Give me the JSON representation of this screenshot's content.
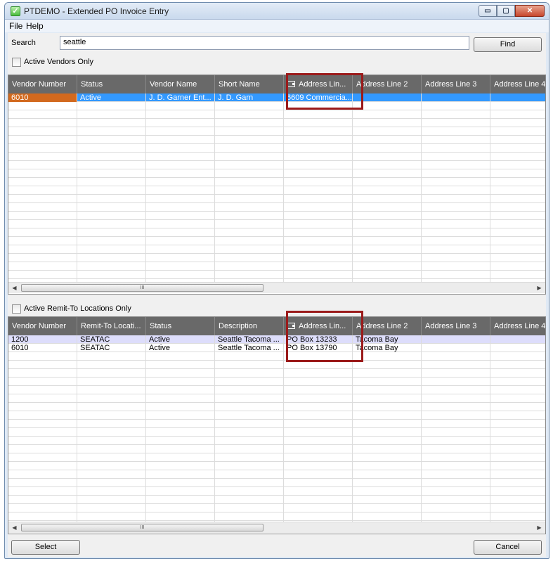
{
  "window": {
    "title": "PTDEMO - Extended PO Invoice Entry",
    "controls": [
      "minimize",
      "maximize",
      "close"
    ],
    "control_glyphs": {
      "minimize": "▭",
      "maximize": "▢",
      "close": "✕"
    }
  },
  "menu": [
    "File",
    "Help"
  ],
  "search": {
    "label": "Search",
    "value": "seattle",
    "find_label": "Find"
  },
  "vendors": {
    "filter_label": "Active Vendors Only",
    "columns": [
      "Vendor Number",
      "Status",
      "Vendor Name",
      "Short Name",
      "Address Lin...",
      "Address Line 2",
      "Address Line 3",
      "Address Line 4"
    ],
    "rows": [
      {
        "vendor_number": "6010",
        "status": "Active",
        "vendor_name": "J. D. Garner Ent...",
        "short_name": "J. D. Garn",
        "address_line_1": "6609 Commercia...",
        "address_line_2": "",
        "address_line_3": "",
        "address_line_4": ""
      }
    ],
    "scroll_marker": "III"
  },
  "remit_to": {
    "filter_label": "Active Remit-To Locations Only",
    "columns": [
      "Vendor Number",
      "Remit-To Locati...",
      "Status",
      "Description",
      "Address Lin...",
      "Address Line 2",
      "Address Line 3",
      "Address Line 4"
    ],
    "rows": [
      {
        "vendor_number": "1200",
        "remit_to_location": "SEATAC",
        "status": "Active",
        "description": "Seattle Tacoma ...",
        "address_line_1": "PO Box 13233",
        "address_line_2": "Tacoma Bay",
        "address_line_3": "",
        "address_line_4": ""
      },
      {
        "vendor_number": "6010",
        "remit_to_location": "SEATAC",
        "status": "Active",
        "description": "Seattle Tacoma ...",
        "address_line_1": "PO Box 13790",
        "address_line_2": "Tacoma Bay",
        "address_line_3": "",
        "address_line_4": ""
      }
    ],
    "scroll_marker": "III"
  },
  "footer": {
    "select_label": "Select",
    "cancel_label": "Cancel"
  },
  "colors": {
    "header": "#696969",
    "selected_row": "#3399ff",
    "current_cell": "#d2691e",
    "alt_row": "#ddddfb",
    "highlight": "#9b1b1b"
  }
}
